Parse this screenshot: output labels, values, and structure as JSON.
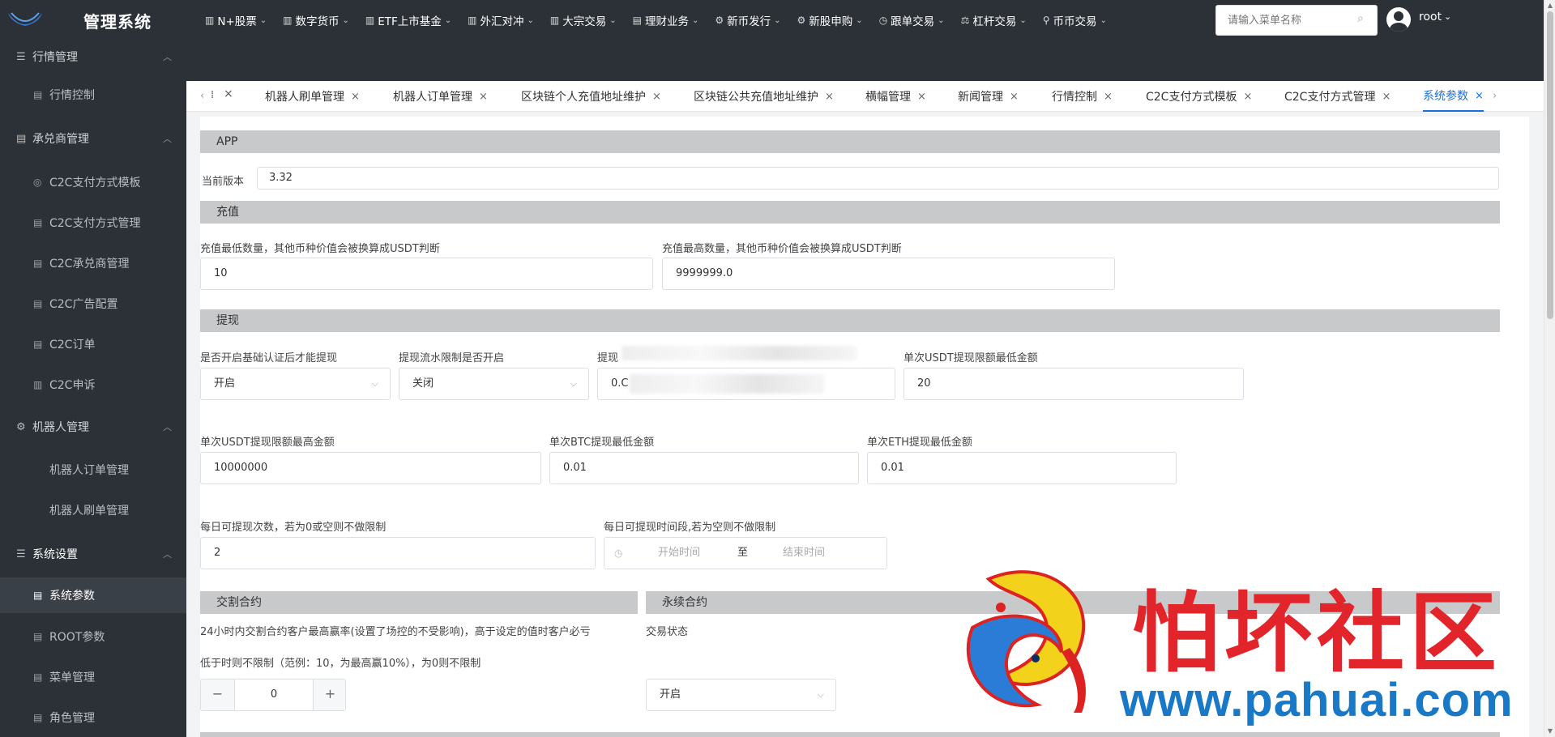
{
  "brand": "管理系统",
  "topnav": [
    {
      "label": "N+股票",
      "icon": "bar-chart-icon"
    },
    {
      "label": "数字货币",
      "icon": "bar-chart-icon"
    },
    {
      "label": "ETF上市基金",
      "icon": "bar-chart-icon"
    },
    {
      "label": "外汇对冲",
      "icon": "bar-chart-icon"
    },
    {
      "label": "大宗交易",
      "icon": "bar-chart-icon"
    },
    {
      "label": "理财业务",
      "icon": "list-icon"
    },
    {
      "label": "新币发行",
      "icon": "gear-icon"
    },
    {
      "label": "新股申购",
      "icon": "gear-icon"
    },
    {
      "label": "跟单交易",
      "icon": "clock-icon"
    },
    {
      "label": "杠杆交易",
      "icon": "gavel-icon"
    },
    {
      "label": "币币交易",
      "icon": "pin-icon"
    }
  ],
  "menu_search": {
    "placeholder": "请输入菜单名称"
  },
  "user": {
    "name": "root"
  },
  "sidebar": {
    "groups": [
      {
        "label": "行情管理",
        "icon": "list-icon"
      },
      {
        "label": "承兑商管理",
        "icon": "list-icon"
      },
      {
        "label": "机器人管理",
        "icon": "gear-icon"
      },
      {
        "label": "系统设置",
        "icon": "list-icon"
      }
    ],
    "items": [
      {
        "label": "行情控制",
        "icon": "doc-icon"
      },
      {
        "label": "C2C支付方式模板",
        "icon": "circle-icon"
      },
      {
        "label": "C2C支付方式管理",
        "icon": "doc-icon"
      },
      {
        "label": "C2C承兑商管理",
        "icon": "doc-icon"
      },
      {
        "label": "C2C广告配置",
        "icon": "doc-icon"
      },
      {
        "label": "C2C订单",
        "icon": "doc-icon"
      },
      {
        "label": "C2C申诉",
        "icon": "bar-chart-icon"
      },
      {
        "label": "机器人订单管理",
        "icon": ""
      },
      {
        "label": "机器人刷单管理",
        "icon": ""
      },
      {
        "label": "系统参数",
        "icon": "doc-icon"
      },
      {
        "label": "ROOT参数",
        "icon": "doc-icon"
      },
      {
        "label": "菜单管理",
        "icon": "doc-icon"
      },
      {
        "label": "角色管理",
        "icon": "doc-icon"
      }
    ]
  },
  "tabs": [
    {
      "label": "机器人刷单管理"
    },
    {
      "label": "机器人订单管理"
    },
    {
      "label": "区块链个人充值地址维护"
    },
    {
      "label": "区块链公共充值地址维护"
    },
    {
      "label": "横幅管理"
    },
    {
      "label": "新闻管理"
    },
    {
      "label": "行情控制"
    },
    {
      "label": "C2C支付方式模板"
    },
    {
      "label": "C2C支付方式管理"
    },
    {
      "label": "系统参数"
    }
  ],
  "sections": {
    "app": "APP",
    "recharge": "充值",
    "withdraw": "提现",
    "delivery": "交割合约",
    "perpetual": "永续合约"
  },
  "form": {
    "current_version_label": "当前版本",
    "current_version": "3.32",
    "recharge_min_label": "充值最低数量，其他币种价值会被换算成USDT判断",
    "recharge_min": "10",
    "recharge_max_label": "充值最高数量，其他币种价值会被换算成USDT判断",
    "recharge_max": "9999999.0",
    "kyc_withdraw_label": "是否开启基础认证后才能提现",
    "kyc_withdraw": "开启",
    "flow_limit_label": "提现流水限制是否开启",
    "flow_limit": "关闭",
    "obscured_label": "提现",
    "obscured_value": "0.C",
    "usdt_min_label": "单次USDT提现限额最低金额",
    "usdt_min": "20",
    "usdt_max_label": "单次USDT提现限额最高金额",
    "usdt_max": "10000000",
    "btc_min_label": "单次BTC提现最低金额",
    "btc_min": "0.01",
    "eth_min_label": "单次ETH提现最低金额",
    "eth_min": "0.01",
    "daily_count_label": "每日可提现次数，若为0或空则不做限制",
    "daily_count": "2",
    "daily_time_label": "每日可提现时间段,若为空则不做限制",
    "start_time_placeholder": "开始时间",
    "range_sep": "至",
    "end_time_placeholder": "结束时间",
    "delivery_desc_1": "24小时内交割合约客户最高赢率(设置了场控的不受影响)，高于设定的值时客户必亏",
    "delivery_desc_2": "低于时则不限制（范例：10，为最高赢10%），为0则不限制",
    "delivery_value": "0",
    "trade_status_label": "交易状态",
    "trade_status": "开启"
  },
  "watermark": {
    "cn": "怕坏社区",
    "url": "www.pahuai.com"
  }
}
